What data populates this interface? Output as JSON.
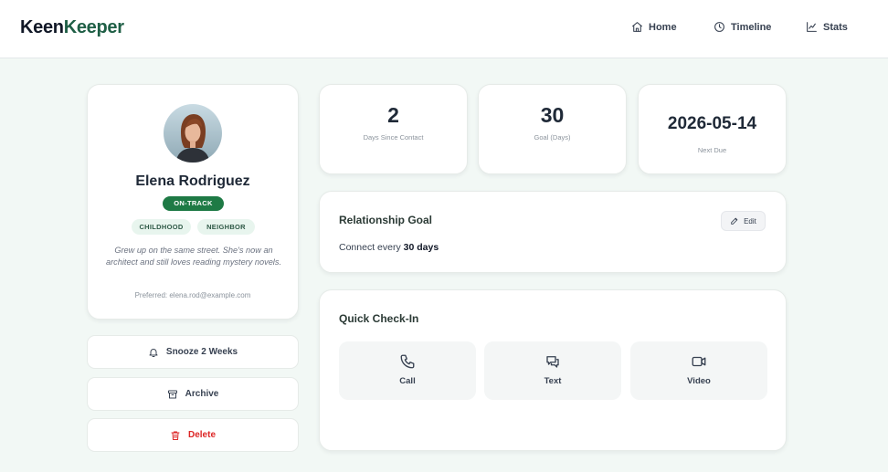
{
  "app": {
    "logo_part1": "Keen",
    "logo_part2": "Keeper"
  },
  "nav": [
    {
      "label": "Home",
      "icon": "home-icon"
    },
    {
      "label": "Timeline",
      "icon": "clock-icon"
    },
    {
      "label": "Stats",
      "icon": "chart-line-icon"
    }
  ],
  "profile": {
    "name": "Elena Rodriguez",
    "status": "ON-TRACK",
    "tags": [
      "CHILDHOOD",
      "NEIGHBOR"
    ],
    "bio": "Grew up on the same street. She's now an architect and still loves reading mystery novels.",
    "preferred": "Preferred: elena.rod@example.com"
  },
  "actions": {
    "snooze": "Snooze 2 Weeks",
    "archive": "Archive",
    "delete": "Delete"
  },
  "stats": [
    {
      "value": "2",
      "label": "Days Since Contact"
    },
    {
      "value": "30",
      "label": "Goal (Days)"
    },
    {
      "value": "2026-05-14",
      "label": "Next Due"
    }
  ],
  "goal": {
    "title": "Relationship Goal",
    "edit_label": "Edit",
    "text_prefix": "Connect every ",
    "text_value": "30 days"
  },
  "checkin": {
    "title": "Quick Check-In",
    "options": [
      "Call",
      "Text",
      "Video"
    ]
  },
  "colors": {
    "brand_dark": "#111827",
    "brand_green": "#1f5f46",
    "status_green": "#1e7a45",
    "tag_bg": "#e8f5ee",
    "delete_red": "#dc2626",
    "page_bg": "#f2f8f5"
  }
}
